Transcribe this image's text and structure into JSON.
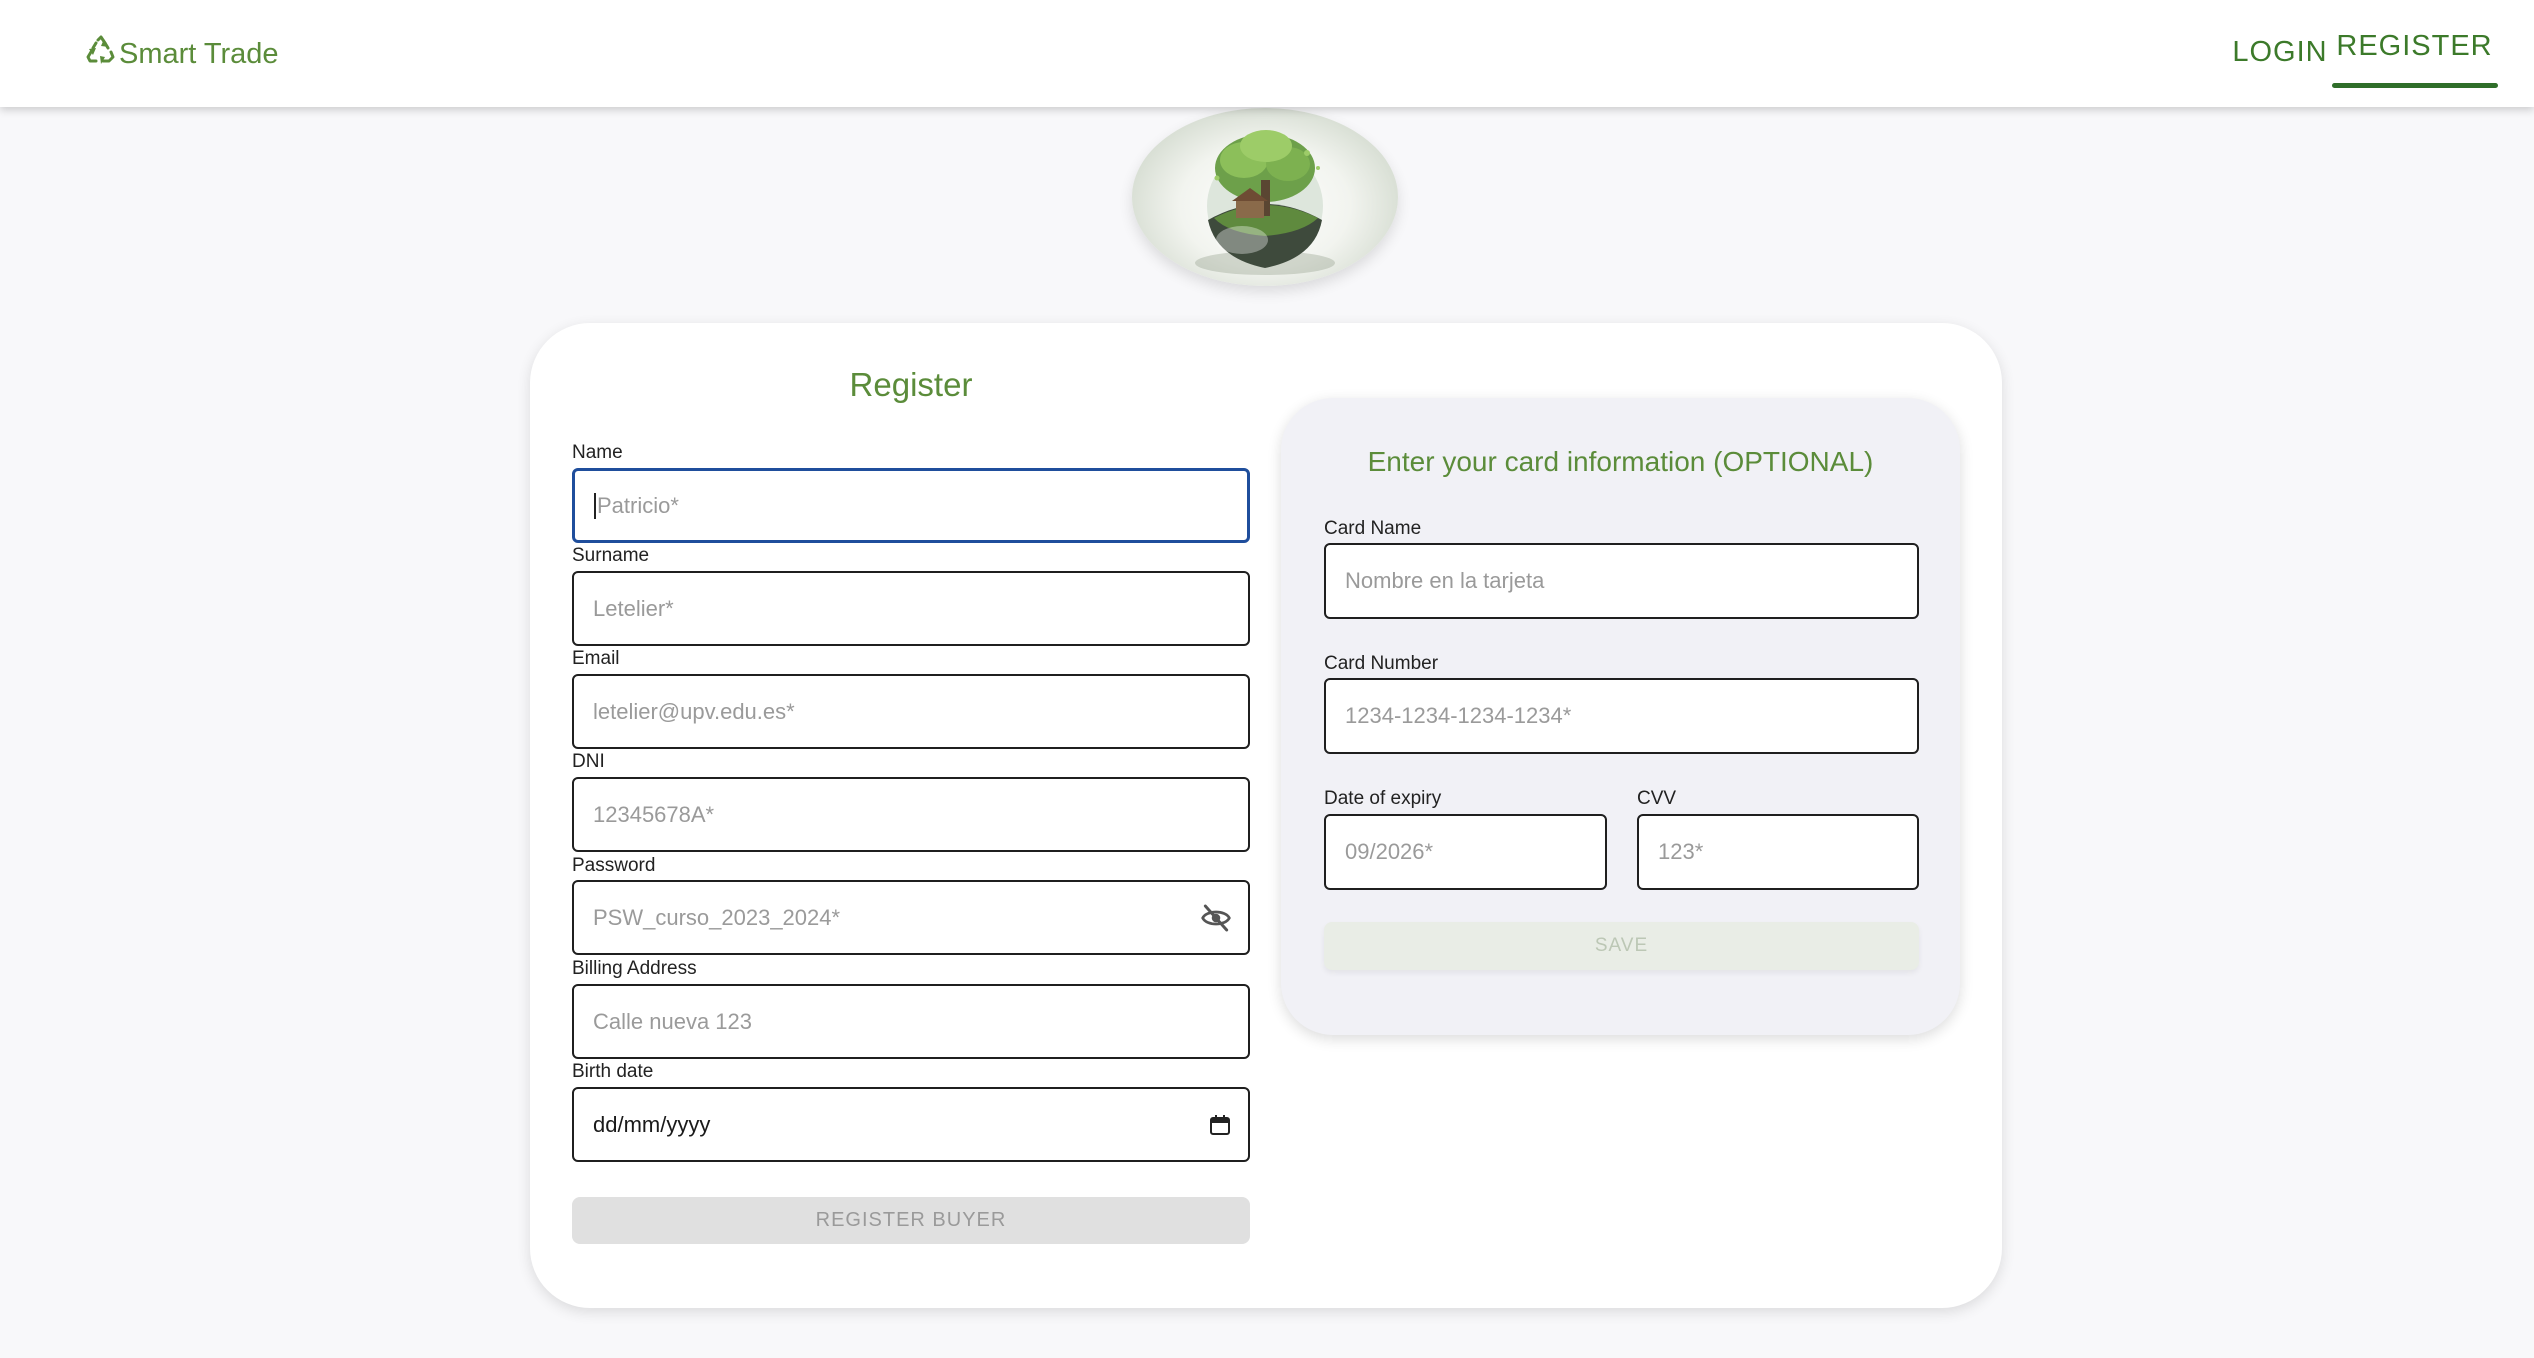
{
  "header": {
    "brand": "Smart Trade",
    "brand_icon": "recycle-icon",
    "nav": {
      "login": "LOGIN",
      "register": "REGISTER"
    },
    "active_nav": "REGISTER",
    "accent_color": "#2f6e2a"
  },
  "logo": {
    "icon": "earth-globe-tree-icon"
  },
  "register_form": {
    "title": "Register",
    "fields": {
      "name": {
        "label": "Name",
        "placeholder": "Patricio*"
      },
      "surname": {
        "label": "Surname",
        "placeholder": "Letelier*"
      },
      "email": {
        "label": "Email",
        "placeholder": "letelier@upv.edu.es*"
      },
      "dni": {
        "label": "DNI",
        "placeholder": "12345678A*"
      },
      "password": {
        "label": "Password",
        "placeholder": "PSW_curso_2023_2024*",
        "icon": "eye-off-icon"
      },
      "billing_address": {
        "label": "Billing Address",
        "placeholder": "Calle nueva 123"
      },
      "birth_date": {
        "label": "Birth date",
        "value": "dd/mm/yyyy",
        "icon": "calendar-icon"
      }
    },
    "submit_label": "REGISTER BUYER"
  },
  "card_form": {
    "title": "Enter your card information (OPTIONAL)",
    "fields": {
      "card_name": {
        "label": "Card Name",
        "placeholder": "Nombre en la tarjeta"
      },
      "card_number": {
        "label": "Card Number",
        "placeholder": "1234-1234-1234-1234*"
      },
      "expiry": {
        "label": "Date of expiry",
        "placeholder": "09/2026*"
      },
      "cvv": {
        "label": "CVV",
        "placeholder": "123*"
      }
    },
    "save_label": "SAVE"
  }
}
